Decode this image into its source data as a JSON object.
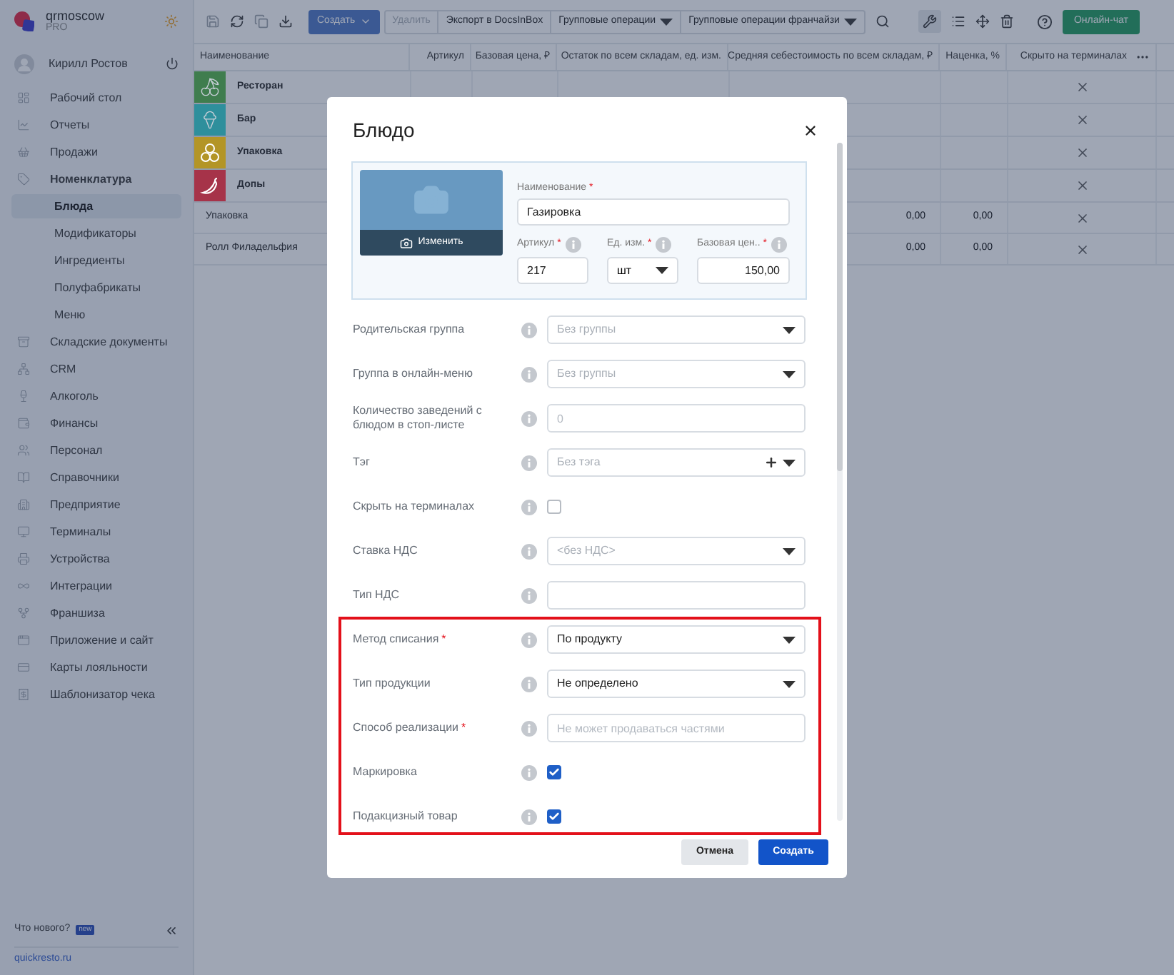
{
  "sidebar": {
    "brand": {
      "name": "qrmoscow",
      "plan": "PRO"
    },
    "user": {
      "name": "Кирилл Ростов"
    },
    "items": [
      {
        "label": "Рабочий стол",
        "selected": false
      },
      {
        "label": "Отчеты",
        "selected": false
      },
      {
        "label": "Продажи",
        "selected": false
      },
      {
        "label": "Номенклатура",
        "selected": false,
        "expanded": true,
        "children": [
          {
            "label": "Блюда",
            "selected": true
          },
          {
            "label": "Модификаторы",
            "selected": false
          },
          {
            "label": "Ингредиенты",
            "selected": false
          },
          {
            "label": "Полуфабрикаты",
            "selected": false
          },
          {
            "label": "Меню",
            "selected": false
          }
        ]
      },
      {
        "label": "Складские документы",
        "selected": false
      },
      {
        "label": "CRM",
        "selected": false
      },
      {
        "label": "Алкоголь",
        "selected": false
      },
      {
        "label": "Финансы",
        "selected": false
      },
      {
        "label": "Персонал",
        "selected": false
      },
      {
        "label": "Справочники",
        "selected": false
      },
      {
        "label": "Предприятие",
        "selected": false
      },
      {
        "label": "Терминалы",
        "selected": false
      },
      {
        "label": "Устройства",
        "selected": false
      },
      {
        "label": "Интеграции",
        "selected": false
      },
      {
        "label": "Франшиза",
        "selected": false
      },
      {
        "label": "Приложение и сайт",
        "selected": false
      },
      {
        "label": "Карты лояльности",
        "selected": false
      },
      {
        "label": "Шаблонизатор чека",
        "selected": false
      }
    ],
    "whats_new": "Что нового?",
    "badge": "new",
    "link": "quickresto.ru"
  },
  "toolbar": {
    "create": "Создать",
    "actions": [
      {
        "label": "Удалить",
        "disabled": true,
        "dropdown": false
      },
      {
        "label": "Экспорт в DocsInBox",
        "disabled": false,
        "dropdown": false
      },
      {
        "label": "Групповые операции",
        "disabled": false,
        "dropdown": true
      },
      {
        "label": "Групповые операции франчайзи",
        "disabled": false,
        "dropdown": true
      }
    ],
    "chat": "Онлайн-чат"
  },
  "table": {
    "columns": [
      "Наименование",
      "Артикул",
      "Базовая цена, ₽",
      "Остаток по всем складам, ед. изм.",
      "Средняя себестоимость по всем складам, ₽",
      "Наценка, %",
      "Скрыто на терминалах"
    ],
    "rows": [
      {
        "kind": "group",
        "name": "Ресторан",
        "color": "#3f7d4e",
        "hidden": true
      },
      {
        "kind": "group",
        "name": "Бар",
        "color": "#2e8f9c",
        "hidden": true
      },
      {
        "kind": "group",
        "name": "Упаковка",
        "color": "#b39526",
        "hidden": true
      },
      {
        "kind": "group",
        "name": "Допы",
        "color": "#a63349",
        "hidden": true
      },
      {
        "kind": "item",
        "name": "Упаковка",
        "cost": "0,00",
        "markup": "0,00",
        "hidden": true
      },
      {
        "kind": "item",
        "name": "Ролл Филадельфия",
        "cost": "0,00",
        "markup": "0,00",
        "hidden": true
      }
    ]
  },
  "modal": {
    "title": "Блюдо",
    "photo_button": "Изменить",
    "required_mark": "*",
    "name_field": {
      "label": "Наименование",
      "required": true,
      "value": "Газировка"
    },
    "small_fields": [
      {
        "kind": "input",
        "label": "Артикул",
        "required": true,
        "value": "217"
      },
      {
        "kind": "select",
        "label": "Ед. изм.",
        "required": true,
        "value": "шт"
      },
      {
        "kind": "price",
        "label": "Базовая цен..",
        "required": true,
        "value": "150,00"
      }
    ],
    "fields": [
      {
        "kind": "select",
        "label": "Родительская группа",
        "required": false,
        "placeholder": "Без группы"
      },
      {
        "kind": "select",
        "label": "Группа в онлайн-меню",
        "required": false,
        "placeholder": "Без группы"
      },
      {
        "kind": "input",
        "label": "Количество заведений с блюдом в стоп-листе",
        "required": false,
        "placeholder": "0"
      },
      {
        "kind": "tag",
        "label": "Тэг",
        "required": false,
        "placeholder": "Без тэга"
      },
      {
        "kind": "checkbox",
        "label": "Скрыть на терминалах",
        "required": false,
        "checked": false
      },
      {
        "kind": "select",
        "label": "Ставка НДС",
        "required": false,
        "placeholder": "<без НДС>"
      },
      {
        "kind": "input",
        "label": "Тип НДС",
        "required": false
      }
    ],
    "highlighted_fields": [
      {
        "kind": "select",
        "label": "Метод списания",
        "required": true,
        "value": "По продукту"
      },
      {
        "kind": "select",
        "label": "Тип продукции",
        "required": false,
        "value": "Не определено"
      },
      {
        "kind": "input",
        "label": "Способ реализации",
        "required": true,
        "placeholder": "Не может продаваться частями"
      },
      {
        "kind": "checkbox",
        "label": "Маркировка",
        "required": false,
        "checked": true
      },
      {
        "kind": "checkbox",
        "label": "Подакцизный товар",
        "required": false,
        "checked": true
      }
    ],
    "cancel": "Отмена",
    "submit": "Создать"
  }
}
